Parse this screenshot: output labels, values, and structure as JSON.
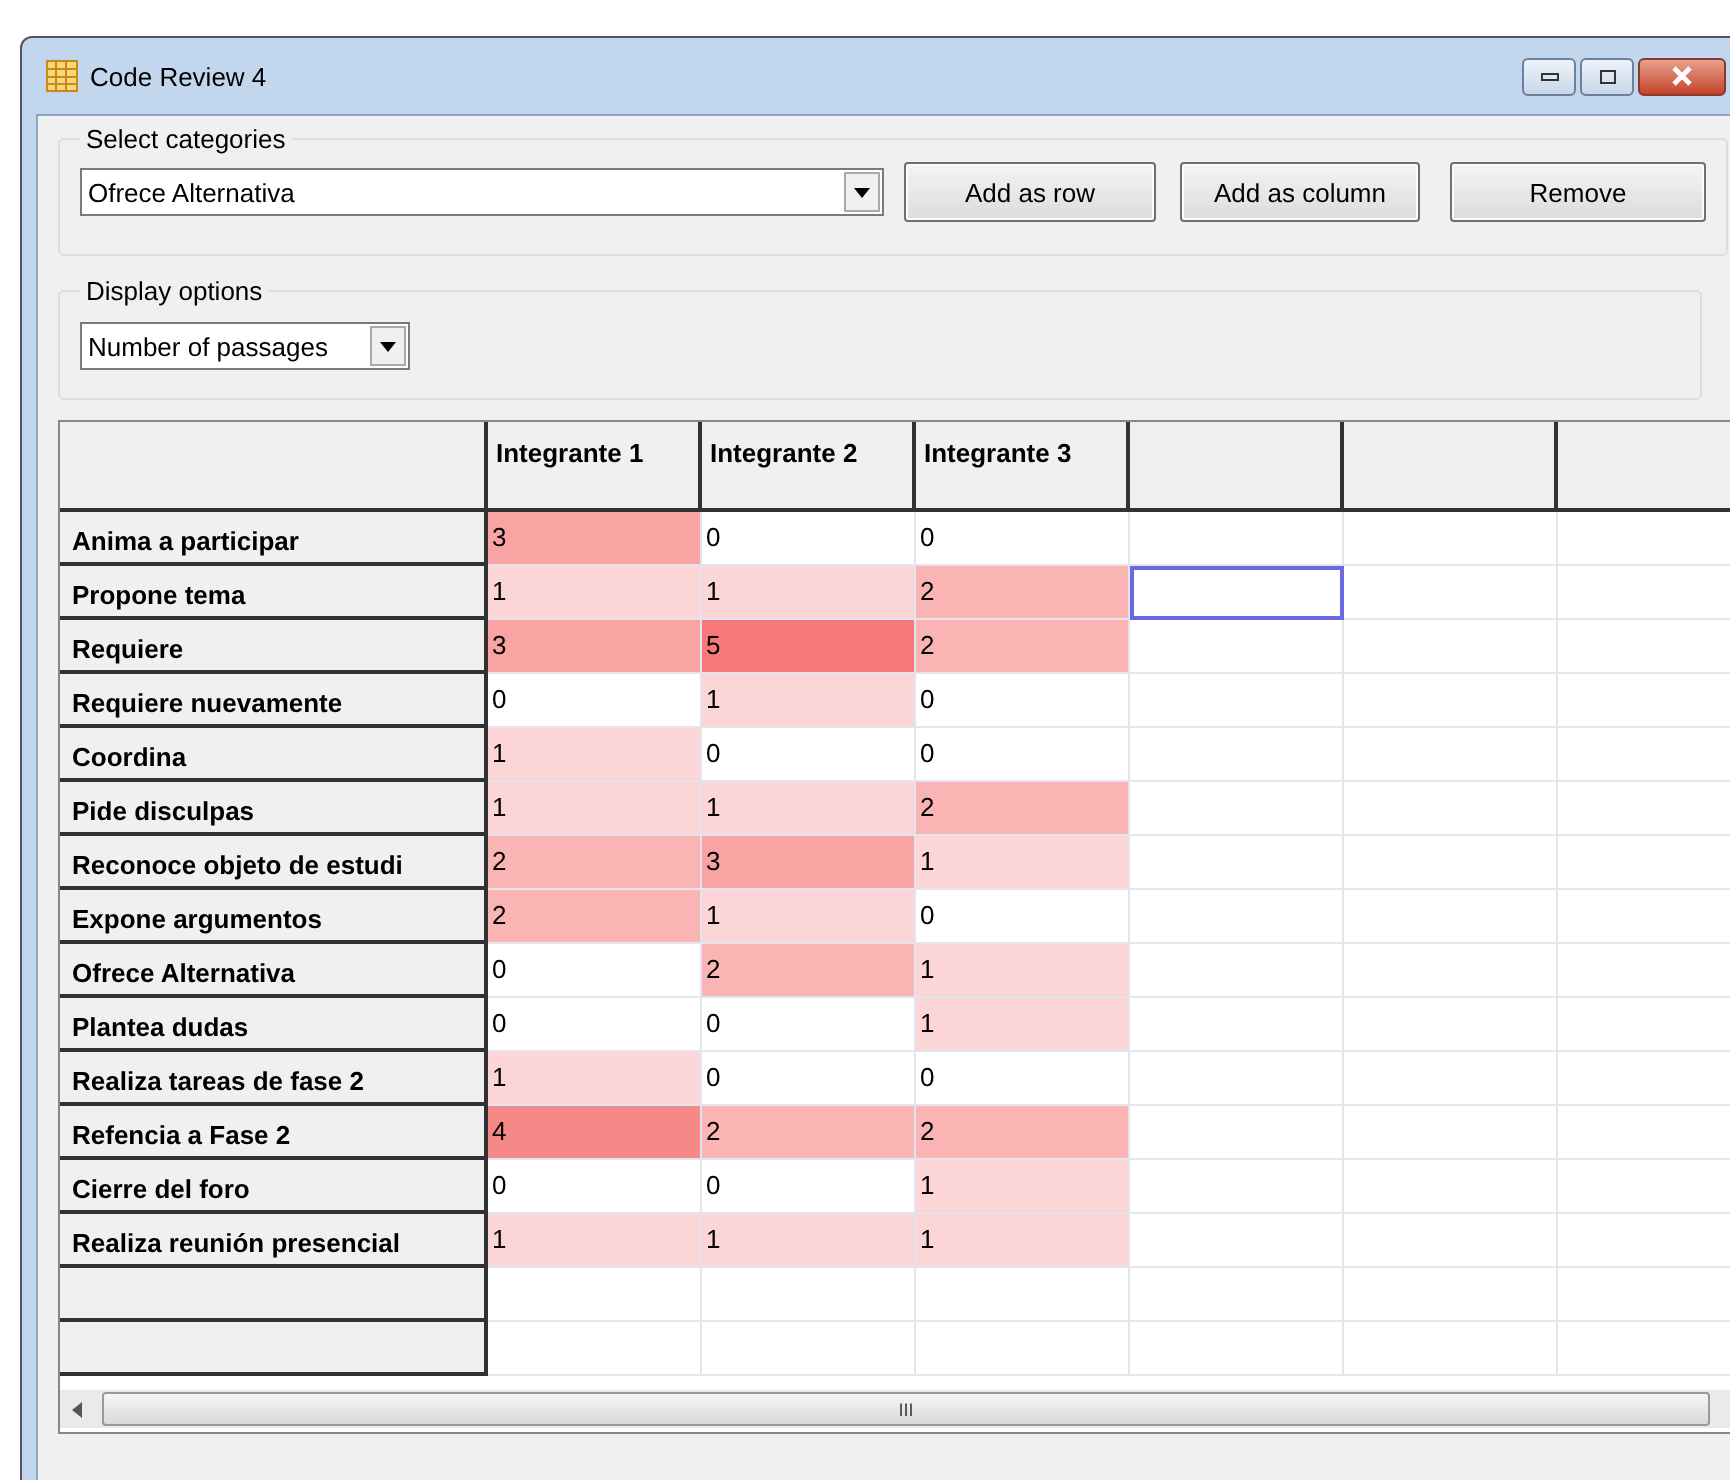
{
  "window": {
    "title": "Code Review 4"
  },
  "select_categories": {
    "label": "Select categories",
    "dropdown": "Ofrece Alternativa",
    "buttons": [
      "Add as row",
      "Add as column",
      "Remove"
    ]
  },
  "display_options": {
    "label": "Display options",
    "dropdown": "Number of passages"
  },
  "table": {
    "columns": [
      "Integrante 1",
      "Integrante 2",
      "Integrante 3"
    ],
    "rows": [
      {
        "label": "Anima a participar",
        "cells": [
          {
            "value": "3",
            "color": "#f9a3a3",
            "selected": false
          },
          {
            "value": "0",
            "color": "#ffffff",
            "selected": false
          },
          {
            "value": "0",
            "color": "#ffffff",
            "selected": false
          },
          {
            "selected": false
          },
          {
            "selected": false
          },
          {
            "selected": false
          }
        ]
      },
      {
        "label": "Propone tema",
        "cells": [
          {
            "value": "1",
            "color": "#fcd6d6",
            "selected": false
          },
          {
            "value": "1",
            "color": "#fcd6d6",
            "selected": false
          },
          {
            "value": "2",
            "color": "#fab4b4",
            "selected": false
          },
          {
            "selected": true
          },
          {
            "selected": false
          },
          {
            "selected": false
          }
        ]
      },
      {
        "label": "Requiere",
        "cells": [
          {
            "value": "3",
            "color": "#f9a3a3",
            "selected": false
          },
          {
            "value": "5",
            "color": "#f67878",
            "selected": false
          },
          {
            "value": "2",
            "color": "#fab4b4",
            "selected": false
          },
          {
            "selected": false
          },
          {
            "selected": false
          },
          {
            "selected": false
          }
        ]
      },
      {
        "label": "Requiere nuevamente",
        "cells": [
          {
            "value": "0",
            "color": "#ffffff",
            "selected": false
          },
          {
            "value": "1",
            "color": "#fcd6d6",
            "selected": false
          },
          {
            "value": "0",
            "color": "#ffffff",
            "selected": false
          },
          {
            "selected": false
          },
          {
            "selected": false
          },
          {
            "selected": false
          }
        ]
      },
      {
        "label": "Coordina",
        "cells": [
          {
            "value": "1",
            "color": "#fcd6d6",
            "selected": false
          },
          {
            "value": "0",
            "color": "#ffffff",
            "selected": false
          },
          {
            "value": "0",
            "color": "#ffffff",
            "selected": false
          },
          {
            "selected": false
          },
          {
            "selected": false
          },
          {
            "selected": false
          }
        ]
      },
      {
        "label": "Pide disculpas",
        "cells": [
          {
            "value": "1",
            "color": "#fcd6d6",
            "selected": false
          },
          {
            "value": "1",
            "color": "#fcd6d6",
            "selected": false
          },
          {
            "value": "2",
            "color": "#fab4b4",
            "selected": false
          },
          {
            "selected": false
          },
          {
            "selected": false
          },
          {
            "selected": false
          }
        ]
      },
      {
        "label": "Reconoce objeto de estudi",
        "cells": [
          {
            "value": "2",
            "color": "#fab4b4",
            "selected": false
          },
          {
            "value": "3",
            "color": "#f9a3a3",
            "selected": false
          },
          {
            "value": "1",
            "color": "#fcd6d6",
            "selected": false
          },
          {
            "selected": false
          },
          {
            "selected": false
          },
          {
            "selected": false
          }
        ]
      },
      {
        "label": "Expone argumentos",
        "cells": [
          {
            "value": "2",
            "color": "#fab4b4",
            "selected": false
          },
          {
            "value": "1",
            "color": "#fcd6d6",
            "selected": false
          },
          {
            "value": "0",
            "color": "#ffffff",
            "selected": false
          },
          {
            "selected": false
          },
          {
            "selected": false
          },
          {
            "selected": false
          }
        ]
      },
      {
        "label": "Ofrece Alternativa",
        "cells": [
          {
            "value": "0",
            "color": "#ffffff",
            "selected": false
          },
          {
            "value": "2",
            "color": "#fab4b4",
            "selected": false
          },
          {
            "value": "1",
            "color": "#fcd6d6",
            "selected": false
          },
          {
            "selected": false
          },
          {
            "selected": false
          },
          {
            "selected": false
          }
        ]
      },
      {
        "label": "Plantea dudas",
        "cells": [
          {
            "value": "0",
            "color": "#ffffff",
            "selected": false
          },
          {
            "value": "0",
            "color": "#ffffff",
            "selected": false
          },
          {
            "value": "1",
            "color": "#fcd6d6",
            "selected": false
          },
          {
            "selected": false
          },
          {
            "selected": false
          },
          {
            "selected": false
          }
        ]
      },
      {
        "label": "Realiza tareas de fase 2",
        "cells": [
          {
            "value": "1",
            "color": "#fcd6d6",
            "selected": false
          },
          {
            "value": "0",
            "color": "#ffffff",
            "selected": false
          },
          {
            "value": "0",
            "color": "#ffffff",
            "selected": false
          },
          {
            "selected": false
          },
          {
            "selected": false
          },
          {
            "selected": false
          }
        ]
      },
      {
        "label": "Refencia a Fase 2",
        "cells": [
          {
            "value": "4",
            "color": "#f78888",
            "selected": false
          },
          {
            "value": "2",
            "color": "#fab4b4",
            "selected": false
          },
          {
            "value": "2",
            "color": "#fab4b4",
            "selected": false
          },
          {
            "selected": false
          },
          {
            "selected": false
          },
          {
            "selected": false
          }
        ]
      },
      {
        "label": "Cierre del foro",
        "cells": [
          {
            "value": "0",
            "color": "#ffffff",
            "selected": false
          },
          {
            "value": "0",
            "color": "#ffffff",
            "selected": false
          },
          {
            "value": "1",
            "color": "#fcd6d6",
            "selected": false
          },
          {
            "selected": false
          },
          {
            "selected": false
          },
          {
            "selected": false
          }
        ]
      },
      {
        "label": "Realiza reunión presencial",
        "cells": [
          {
            "value": "1",
            "color": "#fcd6d6",
            "selected": false
          },
          {
            "value": "1",
            "color": "#fcd6d6",
            "selected": false
          },
          {
            "value": "1",
            "color": "#fcd6d6",
            "selected": false
          },
          {
            "selected": false
          },
          {
            "selected": false
          },
          {
            "selected": false
          }
        ]
      }
    ],
    "scrollbar_grip": "III"
  }
}
